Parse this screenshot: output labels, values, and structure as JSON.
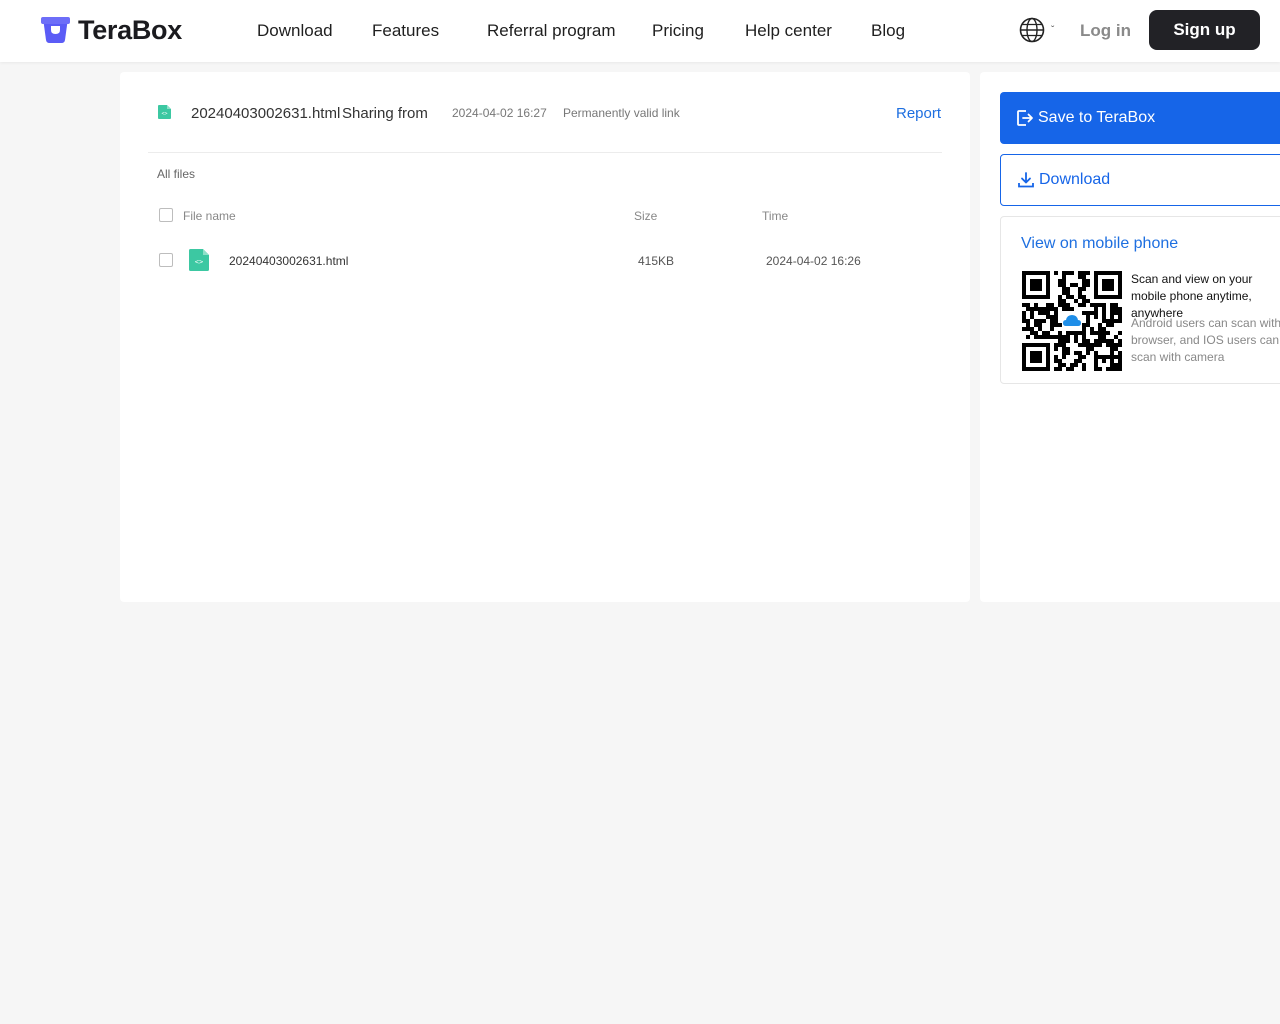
{
  "header": {
    "brand": "TeraBox",
    "nav": [
      "Download",
      "Features",
      "Referral program",
      "Pricing",
      "Help center",
      "Blog"
    ],
    "login": "Log in",
    "signup": "Sign up"
  },
  "share": {
    "file_name": "20240403002631.html",
    "sharing_from": "Sharing from",
    "time": "2024-04-02 16:27",
    "validity": "Permanently valid link",
    "report": "Report"
  },
  "files": {
    "breadcrumb": "All files",
    "columns": {
      "name": "File name",
      "size": "Size",
      "time": "Time"
    },
    "rows": [
      {
        "name": "20240403002631.html",
        "size": "415KB",
        "time": "2024-04-02 16:26"
      }
    ]
  },
  "side": {
    "save_label": "Save to TeraBox",
    "download_label": "Download",
    "mobile_title": "View on mobile phone",
    "scan_text": "Scan and view on your mobile phone anytime, anywhere",
    "scan_hint": "Android users can scan with browser, and IOS users can scan with camera"
  },
  "colors": {
    "accent": "#1665e8",
    "file_icon": "#3cc8a2",
    "signup_bg": "#222226"
  }
}
